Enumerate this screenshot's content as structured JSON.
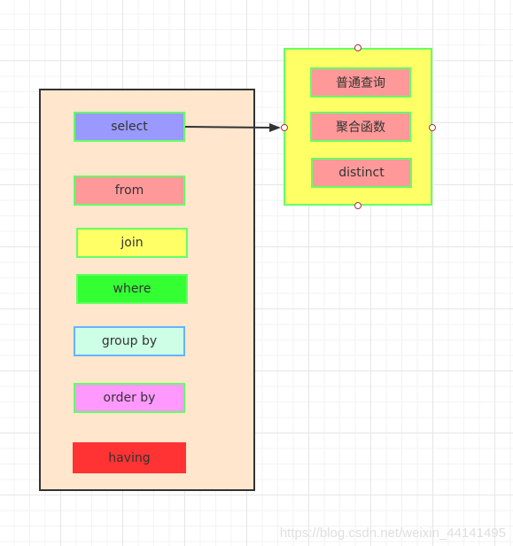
{
  "diagram": {
    "container": {
      "fill": "#FFE6CC",
      "stroke": "#333333",
      "items": [
        {
          "label": "select",
          "fill": "#9999FF",
          "stroke": "#66FF66"
        },
        {
          "label": "from",
          "fill": "#FF9999",
          "stroke": "#66FF66"
        },
        {
          "label": "join",
          "fill": "#FFFF66",
          "stroke": "#66FF66"
        },
        {
          "label": "where",
          "fill": "#33FF33",
          "stroke": "#66FF66"
        },
        {
          "label": "group by",
          "fill": "#CCFFE6",
          "stroke": "#66B2FF"
        },
        {
          "label": "order by",
          "fill": "#FF99FF",
          "stroke": "#66FF66"
        },
        {
          "label": "having",
          "fill": "#FF3333",
          "stroke": "#FF3333"
        }
      ]
    },
    "select_group": {
      "fill": "#FFFF66",
      "stroke": "#66FF66",
      "items": [
        {
          "label": "普通查询",
          "fill": "#FF9999",
          "stroke": "#66FF66"
        },
        {
          "label": "聚合函数",
          "fill": "#FF9999",
          "stroke": "#66FF66"
        },
        {
          "label": "distinct",
          "fill": "#FF9999",
          "stroke": "#66FF66"
        }
      ]
    },
    "edge": {
      "from": "select",
      "to": "select-group",
      "color": "#333333"
    }
  },
  "watermark": "https://blog.csdn.net/weixin_44141495"
}
